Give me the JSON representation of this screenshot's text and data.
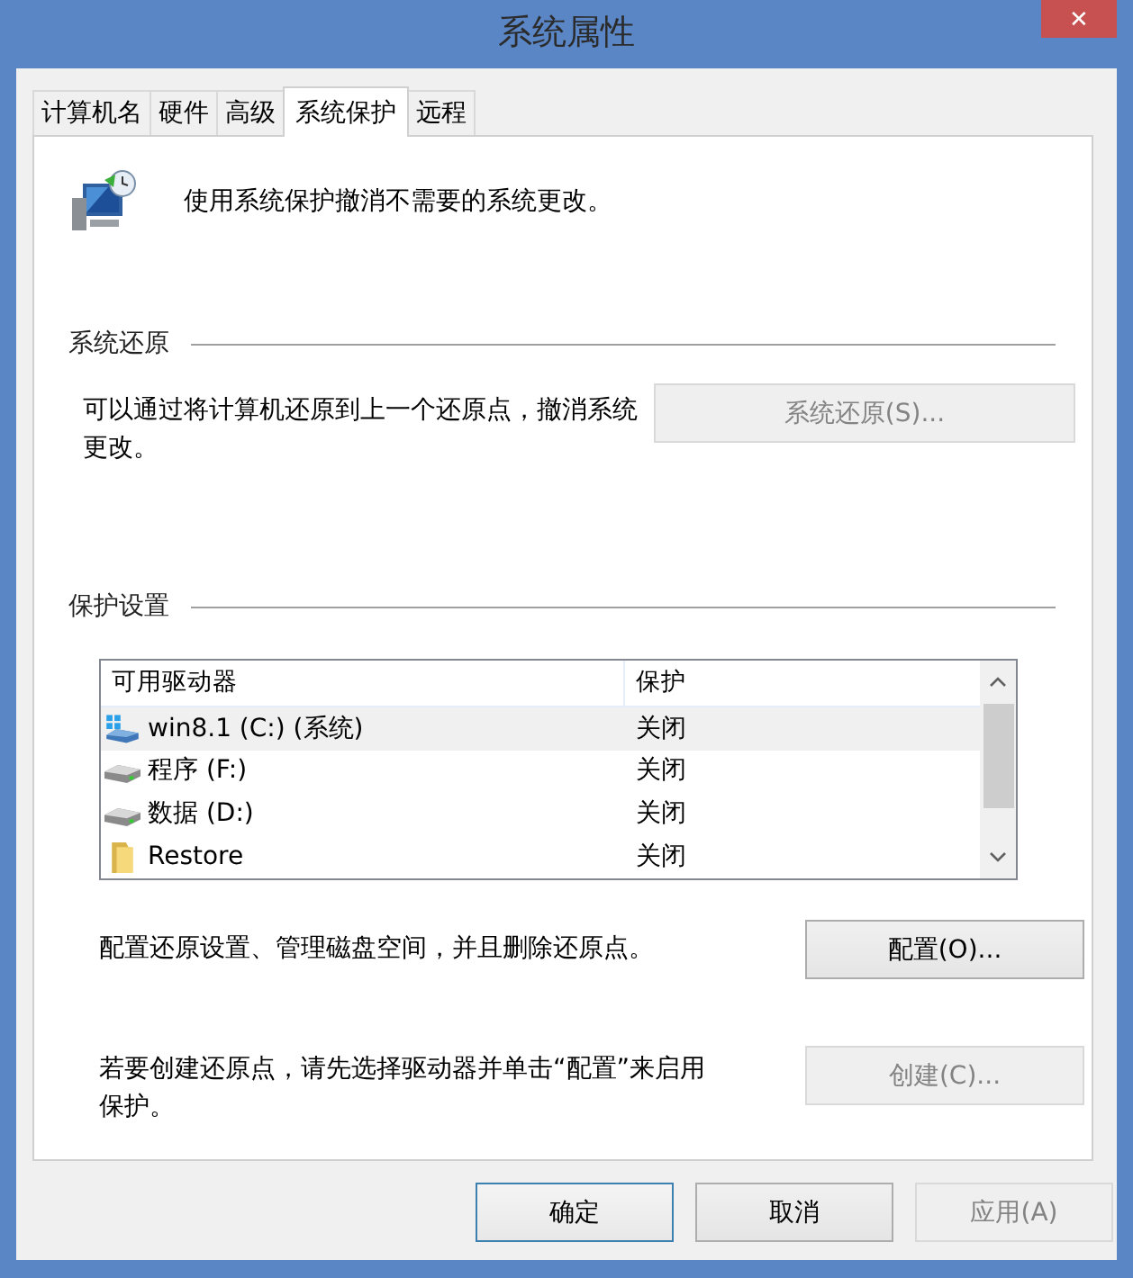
{
  "window": {
    "title": "系统属性",
    "close": "✕"
  },
  "tabs": [
    {
      "label": "计算机名",
      "selected": false
    },
    {
      "label": "硬件",
      "selected": false
    },
    {
      "label": "高级",
      "selected": false
    },
    {
      "label": "系统保护",
      "selected": true
    },
    {
      "label": "远程",
      "selected": false
    }
  ],
  "intro": "使用系统保护撤消不需要的系统更改。",
  "restore_section": {
    "title": "系统还原",
    "text": "可以通过将计算机还原到上一个还原点，撤消系统更改。",
    "button": {
      "label": "系统还原(S)...",
      "disabled": true
    }
  },
  "protection_section": {
    "title": "保护设置",
    "table": {
      "columns": [
        "可用驱动器",
        "保护"
      ],
      "rows": [
        {
          "kind": "system",
          "name": "win8.1 (C:) (系统)",
          "protection": "关闭",
          "selected": true
        },
        {
          "kind": "drive",
          "name": "程序 (F:)",
          "protection": "关闭",
          "selected": false
        },
        {
          "kind": "drive",
          "name": "数据 (D:)",
          "protection": "关闭",
          "selected": false
        },
        {
          "kind": "folder",
          "name": "Restore",
          "protection": "关闭",
          "selected": false
        }
      ]
    },
    "configure": {
      "text": "配置还原设置、管理磁盘空间，并且删除还原点。",
      "button": {
        "label": "配置(O)...",
        "disabled": false
      }
    },
    "create": {
      "text": "若要创建还原点，请先选择驱动器并单击“配置”来启用保护。",
      "button": {
        "label": "创建(C)...",
        "disabled": true
      }
    }
  },
  "buttons": [
    {
      "label": "确定",
      "disabled": false,
      "default": true
    },
    {
      "label": "取消",
      "disabled": false,
      "default": false
    },
    {
      "label": "应用(A)",
      "disabled": true,
      "default": false
    }
  ]
}
